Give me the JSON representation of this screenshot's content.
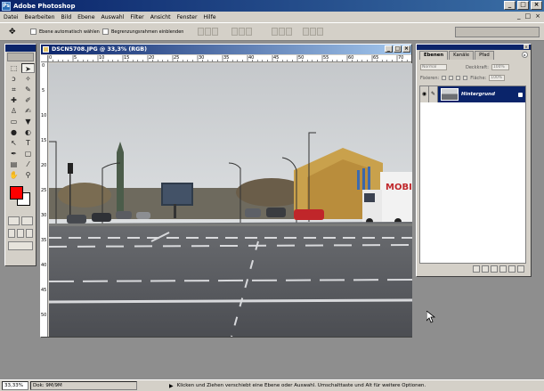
{
  "window": {
    "title": "Adobe Photoshop",
    "app_icon": "Ps",
    "minimize": "_",
    "maximize": "□",
    "close": "×"
  },
  "menu": {
    "items": [
      "Datei",
      "Bearbeiten",
      "Bild",
      "Ebene",
      "Auswahl",
      "Filter",
      "Ansicht",
      "Fenster",
      "Hilfe"
    ],
    "doc_controls": [
      "_",
      "□",
      "×"
    ]
  },
  "options": {
    "auto_select_label": "Ebene automatisch wählen",
    "bounding_box_label": "Begrenzungsrahmen einblenden"
  },
  "document": {
    "title": "DSCN5708.JPG @ 33,3% (RGB)",
    "ruler_h": [
      "0",
      "5",
      "10",
      "15",
      "20",
      "25",
      "30",
      "35",
      "40",
      "45",
      "50",
      "55",
      "60",
      "65",
      "70"
    ],
    "ruler_v": [
      "0",
      "5",
      "10",
      "15",
      "20",
      "25",
      "30",
      "35",
      "40",
      "45",
      "50"
    ],
    "truck_text": "MOBI"
  },
  "layers_palette": {
    "tabs": [
      "Ebenen",
      "Kanäle",
      "Pfad"
    ],
    "blend_mode": "Normal",
    "opacity_label": "Deckkraft:",
    "opacity_value": "100%",
    "lock_label": "Fixieren:",
    "fill_label": "Fläche:",
    "fill_value": "100%",
    "layers": [
      {
        "name": "Hintergrund",
        "visible": true,
        "locked": true
      }
    ]
  },
  "status": {
    "zoom": "33,33%",
    "doc_size": "Dok: 9M/9M",
    "hint": "Klicken und Ziehen verschiebt eine Ebene oder Auswahl. Umschalttaste und Alt für weitere Optionen."
  },
  "colors": {
    "foreground": "#ff0000",
    "background": "#ffffff",
    "titlebar": "#0a246a"
  }
}
